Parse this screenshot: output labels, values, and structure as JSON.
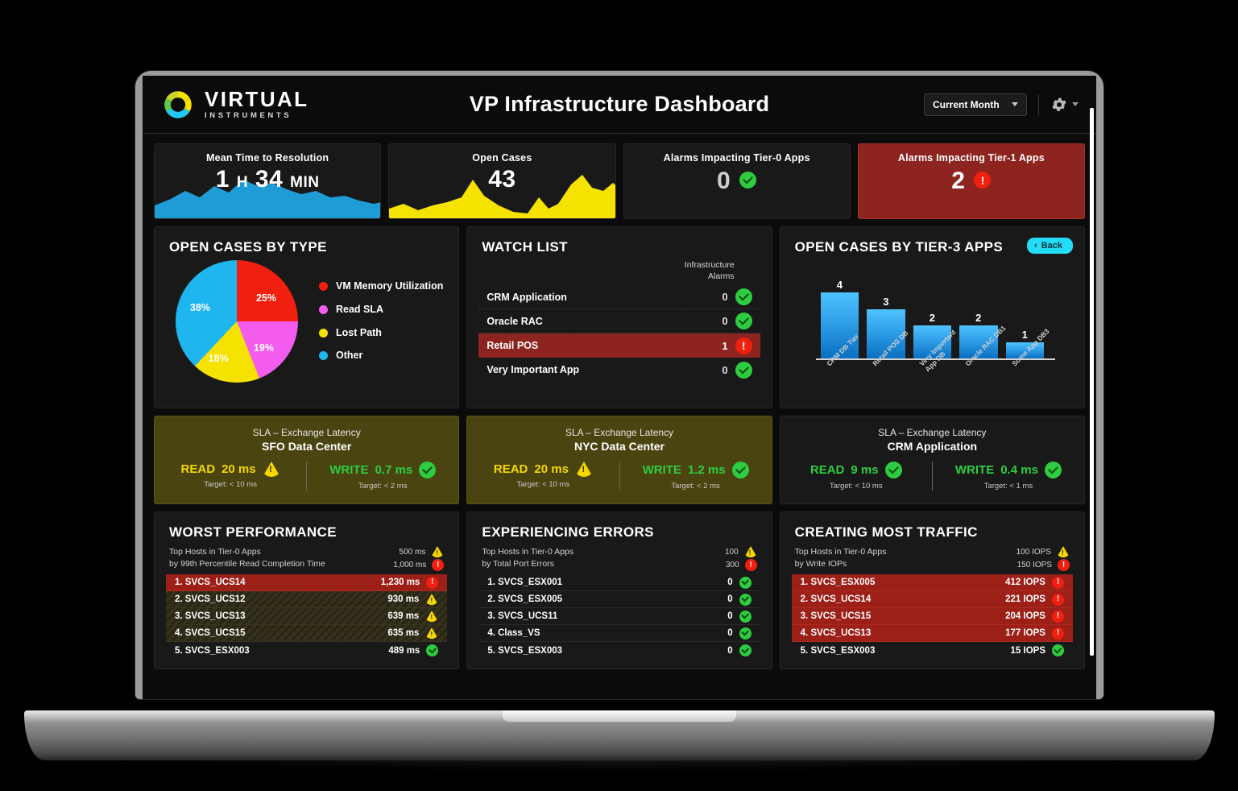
{
  "header": {
    "brand_name": "VIRTUAL",
    "brand_sub": "INSTRUMENTS",
    "title": "VP Infrastructure Dashboard",
    "period_value": "Current Month",
    "gear_icon": "gear-icon"
  },
  "kpis": [
    {
      "title": "Mean Time to Resolution",
      "value": "1",
      "unit1": "H",
      "value2": "34",
      "unit2": "MIN",
      "spark_color": "#1f9bd6",
      "type": "spark"
    },
    {
      "title": "Open Cases",
      "value": "43",
      "spark_color": "#f5e200",
      "type": "spark"
    },
    {
      "title": "Alarms Impacting Tier-0 Apps",
      "value": "0",
      "status": "ok",
      "type": "status"
    },
    {
      "title": "Alarms Impacting Tier-1 Apps",
      "value": "2",
      "status": "crit",
      "type": "status",
      "critical": true
    }
  ],
  "open_cases_by_type": {
    "title": "OPEN CASES BY TYPE",
    "chart_data": {
      "type": "pie",
      "title": "OPEN CASES BY TYPE",
      "categories": [
        "VM Memory Utilization",
        "Read SLA",
        "Lost Path",
        "Other"
      ],
      "values": [
        25,
        19,
        18,
        38
      ],
      "labels": [
        "25%",
        "19%",
        "18%",
        "38%"
      ],
      "colors": [
        "#f01f0f",
        "#f45cf0",
        "#f5e200",
        "#1fb6f0"
      ],
      "legend": "right"
    }
  },
  "watch_list": {
    "title": "WATCH LIST",
    "column_header": "Infrastructure\nAlarms",
    "column_header_line1": "Infrastructure",
    "column_header_line2": "Alarms",
    "rows": [
      {
        "name": "CRM Application",
        "value": "0",
        "status": "ok"
      },
      {
        "name": "Oracle RAC",
        "value": "0",
        "status": "ok"
      },
      {
        "name": "Retail POS",
        "value": "1",
        "status": "crit",
        "critical": true
      },
      {
        "name": "Very Important App",
        "value": "0",
        "status": "ok"
      }
    ]
  },
  "open_cases_by_tier3": {
    "title": "OPEN CASES BY TIER-3 APPS",
    "back_label": "Back",
    "chart_data": {
      "type": "bar",
      "title": "OPEN CASES BY TIER-3 APPS",
      "categories": [
        "CRM DB Tier",
        "Retail POS DB",
        "Very Important App DB",
        "Oracle RAC DB1",
        "Some App DB3"
      ],
      "values": [
        4,
        3,
        2,
        2,
        1
      ],
      "xlabel": "",
      "ylabel": "",
      "ylim": [
        0,
        4
      ],
      "grid": false,
      "legend": "none",
      "bar_color": "#2f9fe8"
    }
  },
  "sla_panels": [
    {
      "sub": "SLA – Exchange Latency",
      "name": "SFO Data Center",
      "warning": true,
      "read": {
        "label": "READ",
        "value": "20 ms",
        "target": "Target: < 10 ms",
        "status": "warn"
      },
      "write": {
        "label": "WRITE",
        "value": "0.7 ms",
        "target": "Target: < 2 ms",
        "status": "ok"
      }
    },
    {
      "sub": "SLA – Exchange Latency",
      "name": "NYC Data Center",
      "warning": true,
      "read": {
        "label": "READ",
        "value": "20 ms",
        "target": "Target: < 10 ms",
        "status": "warn"
      },
      "write": {
        "label": "WRITE",
        "value": "1.2 ms",
        "target": "Target: < 2 ms",
        "status": "ok"
      }
    },
    {
      "sub": "SLA – Exchange Latency",
      "name": "CRM Application",
      "warning": false,
      "read": {
        "label": "READ",
        "value": "9 ms",
        "target": "Target: < 10 ms",
        "status": "ok"
      },
      "write": {
        "label": "WRITE",
        "value": "0.4 ms",
        "target": "Target: < 1 ms",
        "status": "ok"
      }
    }
  ],
  "bottom_panels": [
    {
      "title": "WORST PERFORMANCE",
      "sub_line1": "Top Hosts in Tier-0 Apps",
      "sub_line2": "by 99th Percentile Read Completion Time",
      "threshold_warn": "500 ms",
      "threshold_crit": "1,000 ms",
      "rows": [
        {
          "name": "1. SVCS_UCS14",
          "value": "1,230 ms",
          "status": "crit",
          "bg": "crit"
        },
        {
          "name": "2. SVCS_UCS12",
          "value": "930 ms",
          "status": "warn",
          "bg": "warn"
        },
        {
          "name": "3. SVCS_UCS13",
          "value": "639 ms",
          "status": "warn",
          "bg": "warn"
        },
        {
          "name": "4. SVCS_UCS15",
          "value": "635 ms",
          "status": "warn",
          "bg": "warn"
        },
        {
          "name": "5. SVCS_ESX003",
          "value": "489 ms",
          "status": "ok",
          "bg": "none"
        }
      ]
    },
    {
      "title": "EXPERIENCING ERRORS",
      "sub_line1": "Top Hosts in Tier-0 Apps",
      "sub_line2": "by Total Port Errors",
      "threshold_warn": "100",
      "threshold_crit": "300",
      "rows": [
        {
          "name": "1. SVCS_ESX001",
          "value": "0",
          "status": "ok",
          "bg": "none"
        },
        {
          "name": "2. SVCS_ESX005",
          "value": "0",
          "status": "ok",
          "bg": "none"
        },
        {
          "name": "3. SVCS_UCS11",
          "value": "0",
          "status": "ok",
          "bg": "none"
        },
        {
          "name": "4. Class_VS",
          "value": "0",
          "status": "ok",
          "bg": "none"
        },
        {
          "name": "5. SVCS_ESX003",
          "value": "0",
          "status": "ok",
          "bg": "none"
        }
      ]
    },
    {
      "title": "CREATING MOST TRAFFIC",
      "sub_line1": "Top Hosts in Tier-0 Apps",
      "sub_line2": "by Write IOPs",
      "threshold_warn": "100 IOPS",
      "threshold_crit": "150 IOPS",
      "rows": [
        {
          "name": "1. SVCS_ESX005",
          "value": "412 IOPS",
          "status": "crit",
          "bg": "crit"
        },
        {
          "name": "2. SVCS_UCS14",
          "value": "221 IOPS",
          "status": "crit",
          "bg": "crit"
        },
        {
          "name": "3. SVCS_UCS15",
          "value": "204 IOPS",
          "status": "crit",
          "bg": "crit"
        },
        {
          "name": "4. SVCS_UCS13",
          "value": "177 IOPS",
          "status": "crit",
          "bg": "crit"
        },
        {
          "name": "5. SVCS_ESX003",
          "value": "15 IOPS",
          "status": "ok",
          "bg": "none"
        }
      ]
    }
  ],
  "colors": {
    "critical": "#8e2420",
    "ok": "#2ecc40",
    "warn": "#f5d800",
    "accent": "#23dcf5",
    "bar": "#2f9fe8"
  }
}
